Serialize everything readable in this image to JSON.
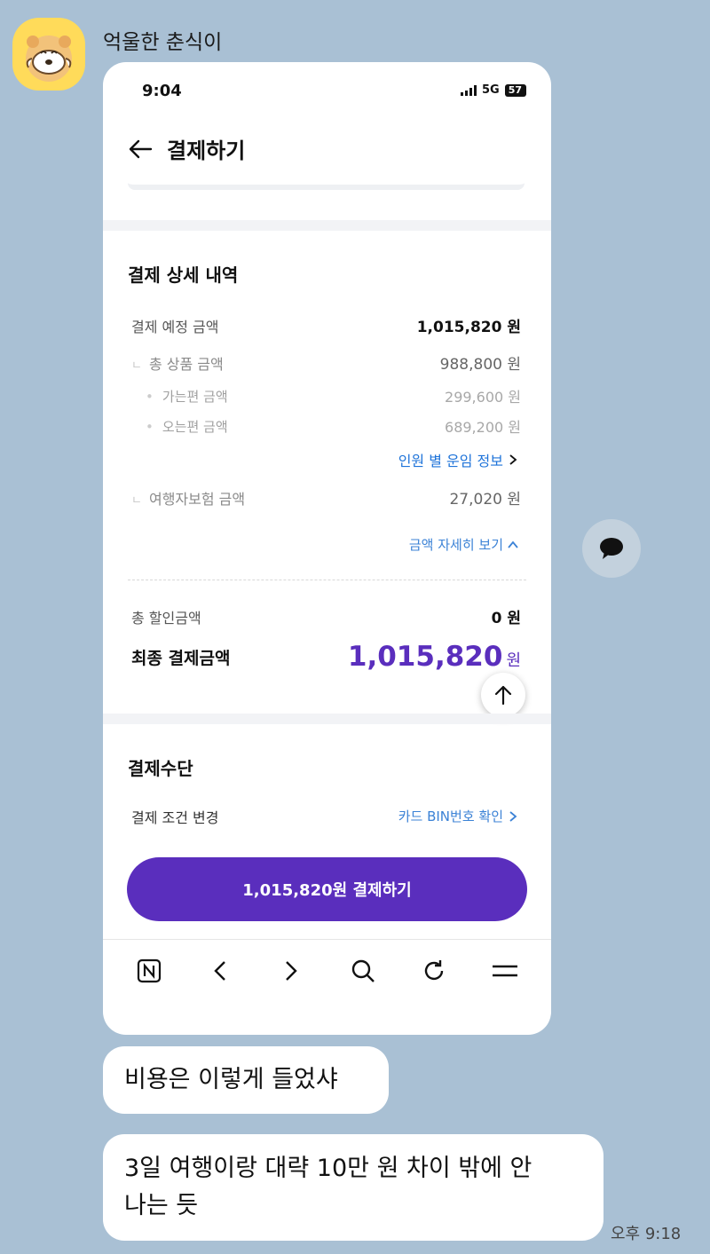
{
  "chat": {
    "sender_name": "억울한 춘식이",
    "messages": [
      "비용은 이렇게 들었샤",
      "3일 여행이랑 대략 10만 원 차이 밖에 안 나는 듯"
    ],
    "message2_line1": "3일 여행이랑 대략 10만 원 차이 밖에 안",
    "message2_line2": "나는 듯",
    "time": "오후 9:18"
  },
  "phone": {
    "status": {
      "time": "9:04",
      "network": "5G",
      "battery": "57"
    },
    "header": {
      "title": "결제하기"
    },
    "details": {
      "section_title": "결제 상세 내역",
      "scheduled_label": "결제 예정 금액",
      "scheduled_value": "1,015,820 원",
      "total_goods_label": "총 상품 금액",
      "total_goods_value": "988,800 원",
      "outbound_label": "가는편 금액",
      "outbound_value": "299,600 원",
      "return_label": "오는편 금액",
      "return_value": "689,200 원",
      "fare_link": "인원 별 운임 정보",
      "insurance_label": "여행자보험 금액",
      "insurance_value": "27,020 원",
      "detail_toggle": "금액 자세히 보기",
      "discount_label": "총 할인금액",
      "discount_value": "0 원",
      "final_label": "최종 결제금액",
      "final_value": "1,015,820",
      "final_unit": "원"
    },
    "payment": {
      "section_title": "결제수단",
      "condition_label": "결제 조건 변경",
      "card_link": "카드 BIN번호 확인"
    },
    "pay_button": "1,015,820원 결제하기",
    "browser_icons": [
      "naver-home-icon",
      "back-icon",
      "forward-icon",
      "search-icon",
      "refresh-icon",
      "menu-icon"
    ]
  },
  "colors": {
    "background": "#a9c0d4",
    "accent": "#5a2ebd",
    "link": "#1e73d9"
  }
}
